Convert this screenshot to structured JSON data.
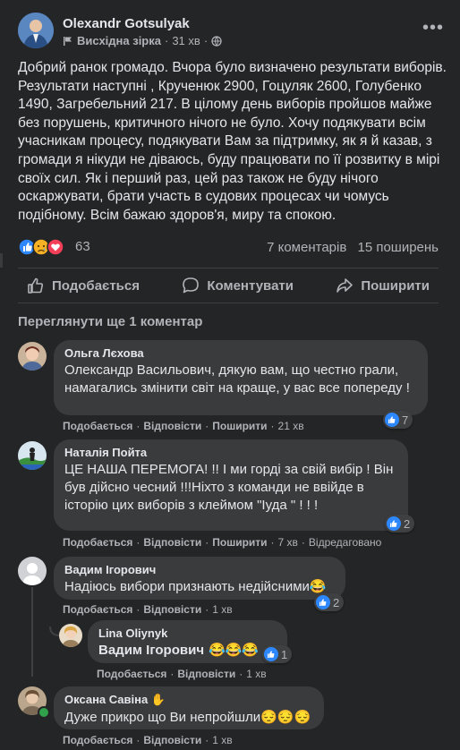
{
  "post": {
    "author": "Olexandr Gotsulyak",
    "group": "Висхідна зірка",
    "time": "31 хв",
    "text": "Добрий ранок громадо. Вчора було визначено результати виборів. Результати наступні , Крученюк 2900, Гоцуляк 2600, Голубенко 1490, Загребельний 217. В цілому день виборів пройшов майже без порушень, критичного нічого не було. Хочу подякувати всім учасникам процесу, подякувати Вам за підтримку, як я й казав, з громади я нікуди не діваюсь, буду працювати по її розвитку в мірі своїх сил. Як і перший раз, цей раз також не буду нічого оскаржувати, брати участь в судових процесах чи чомусь подібному. Всім бажаю здоров'я, миру та спокою.",
    "reaction_count": "63",
    "comments_count": "7 коментарів",
    "shares_count": "15 поширень"
  },
  "actions": {
    "like": "Подобається",
    "comment": "Коментувати",
    "share": "Поширити"
  },
  "view_more": "Переглянути ще 1 коментар",
  "comment_actions": {
    "like": "Подобається",
    "reply": "Відповісти",
    "share": "Поширити",
    "edited": "Відредаговано"
  },
  "comments": [
    {
      "name": "Ольга Лєхова",
      "text": "Олександр Васильович, дякую вам, що честно грали, намагались змінити світ на краще, у вас все попереду !",
      "time": "21 хв",
      "likes": "7"
    },
    {
      "name": "Наталія Пойта",
      "text": "ЦЕ НАША ПЕРЕМОГА! !! І ми горді за свій вибір ! Він був дійсно чесний !!!Ніхто з команди не ввійде в історію цих виборів з клеймом \"Іуда \" ! ! !",
      "time": "7 хв",
      "likes": "2"
    },
    {
      "name": "Вадим Ігорович",
      "text": "Надіюсь вибори признають недійсними😂",
      "time": "1 хв",
      "likes": "2"
    },
    {
      "name": "Lina Oliynyk",
      "mention": "Вадим Ігорович",
      "text": "😂😂😂",
      "time": "1 хв",
      "likes": "1"
    },
    {
      "name": "Оксана Савіна",
      "text": "Дуже прикро що Ви непройшли😔😔😔",
      "time": "1 хв"
    }
  ],
  "colors": {
    "background": "#242526",
    "bubble": "#3a3b3c",
    "like_blue": "#2d88ff",
    "heart_red": "#f33e58",
    "sad_yellow": "#f7b125",
    "secondary_text": "#b0b3b8"
  }
}
